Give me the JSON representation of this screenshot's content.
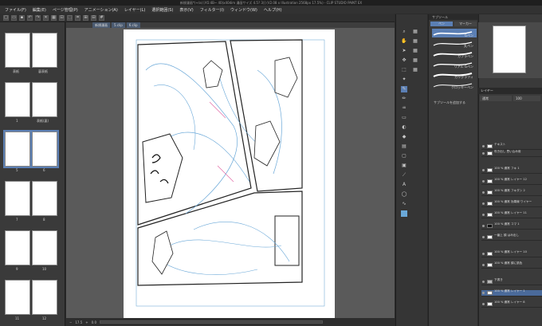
{
  "window": {
    "title": "新規漫画*(+/a) [A5:4B~ 40(x40dim 漫画サイズ 4.5? 3)] (V2.08 x Illustration 2568px 17.5%) - CLIP STUDIO PAINT EX"
  },
  "menu": [
    "ファイル(F)",
    "編集(E)",
    "ページ管理(P)",
    "アニメーション(A)",
    "レイヤー(L)",
    "選択範囲(S)",
    "表示(V)",
    "フィルター(I)",
    "ウィンドウ(W)",
    "ヘルプ(H)"
  ],
  "pages": [
    {
      "label": "表紙"
    },
    {
      "label": "裏表紙"
    },
    {
      "label": "1"
    },
    {
      "label": "表紙(裏)"
    },
    {
      "label": "5"
    },
    {
      "label": "6"
    },
    {
      "label": "7"
    },
    {
      "label": "8"
    },
    {
      "label": "9"
    },
    {
      "label": "10"
    },
    {
      "label": "11"
    },
    {
      "label": "12"
    }
  ],
  "canvas_tabs": [
    "新規漫画",
    "5.clip",
    "6.clip"
  ],
  "statusbar": {
    "zoom": "17.5",
    "angle": "0.0"
  },
  "subtool": {
    "header": "サブツール",
    "tab_pen": "ペン",
    "tab_marker": "マーカー",
    "brushes": [
      "Gペン",
      "丸ペン",
      "カブラペン",
      "リアル Gペン",
      "カリグラフィ",
      "クロッキーペン"
    ],
    "add_label": "サブツールを追加する"
  },
  "right": {
    "layer_header": "レイヤー",
    "blend": "通常",
    "opacity": "100",
    "layers": [
      {
        "name": "テキスト"
      },
      {
        "name": "吹き出し 思い込み用"
      },
      {
        "name": "100 % 通常 フキ 1"
      },
      {
        "name": "100 % 通常 レイヤー 12"
      },
      {
        "name": "100 % 通常 フキダシ 2"
      },
      {
        "name": "100 % 通常 効果線 ワイヤー"
      },
      {
        "name": "100 % 通常 レイヤー 11"
      },
      {
        "name": "100 % 通常 コマ 1"
      },
      {
        "name": "一番上 顔 はみ出し"
      },
      {
        "name": "100 % 通常 レイヤー 10"
      },
      {
        "name": "100 % 通常 顔に肌色"
      },
      {
        "name": "下書き"
      },
      {
        "name": "100 % 通常 レイヤー 1"
      },
      {
        "name": "100 % 通常 レイヤー 8"
      }
    ]
  }
}
